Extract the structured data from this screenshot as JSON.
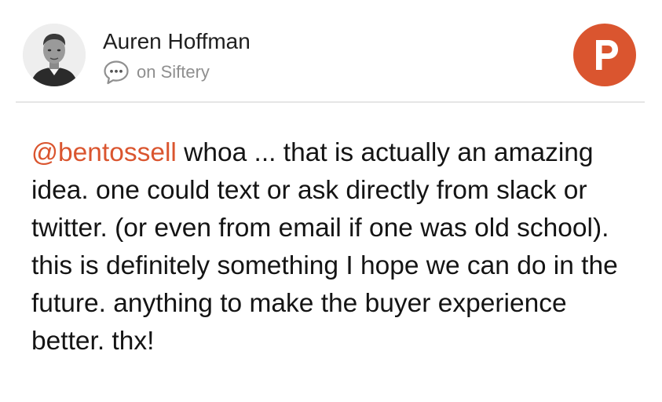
{
  "author": {
    "name": "Auren Hoffman",
    "avatar_icon": "person-avatar"
  },
  "source": {
    "icon": "comment-bubble-icon",
    "text": "on Siftery"
  },
  "brand": {
    "logo_letter": "P",
    "logo_icon": "product-hunt-logo",
    "accent_color": "#da552f"
  },
  "comment": {
    "mention": "@bentossell",
    "text": " whoa ... that is actually an amazing idea. one could text or ask directly from slack or twitter. (or even from email if one was old school). this is definitely something I hope we can do in the future. anything to make the buyer experience better. thx!"
  }
}
